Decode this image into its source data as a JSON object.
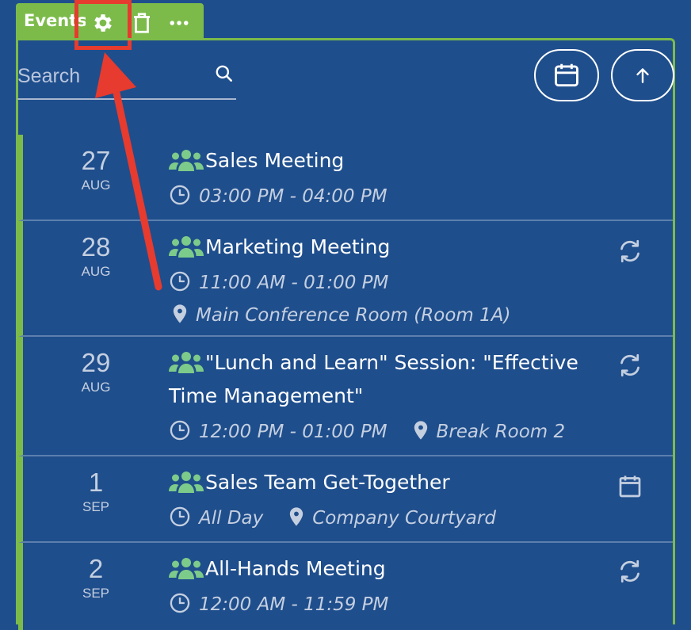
{
  "header": {
    "title": "Events",
    "icons": [
      "gear-icon",
      "trash-icon",
      "more-icon"
    ]
  },
  "search": {
    "placeholder": "Search",
    "value": ""
  },
  "toolbar": {
    "calendar_icon": "calendar-icon",
    "up_icon": "arrow-up-icon"
  },
  "colors": {
    "background": "#1f4e8c",
    "accent_green": "#7cbb4a",
    "annotation_red": "#e63b2e",
    "people_icon": "#7dcb8a"
  },
  "events": [
    {
      "day": "27",
      "month": "AUG",
      "title": "Sales Meeting",
      "time": "03:00 PM - 04:00 PM",
      "location": "",
      "status_icon": ""
    },
    {
      "day": "28",
      "month": "AUG",
      "title": "Marketing Meeting",
      "time": "11:00 AM - 01:00 PM",
      "location": "Main Conference Room (Room 1A)",
      "status_icon": "recurring-icon"
    },
    {
      "day": "29",
      "month": "AUG",
      "title": "\"Lunch and Learn\" Session: \"Effective Time Management\"",
      "time": "12:00 PM - 01:00 PM",
      "location": "Break Room 2",
      "status_icon": "recurring-icon"
    },
    {
      "day": "1",
      "month": "SEP",
      "title": "Sales Team Get-Together",
      "time": "All Day",
      "location": "Company Courtyard",
      "status_icon": "calendar-icon"
    },
    {
      "day": "2",
      "month": "SEP",
      "title": "All-Hands Meeting",
      "time": "12:00 AM - 11:59 PM",
      "location": "",
      "status_icon": "recurring-icon"
    }
  ]
}
